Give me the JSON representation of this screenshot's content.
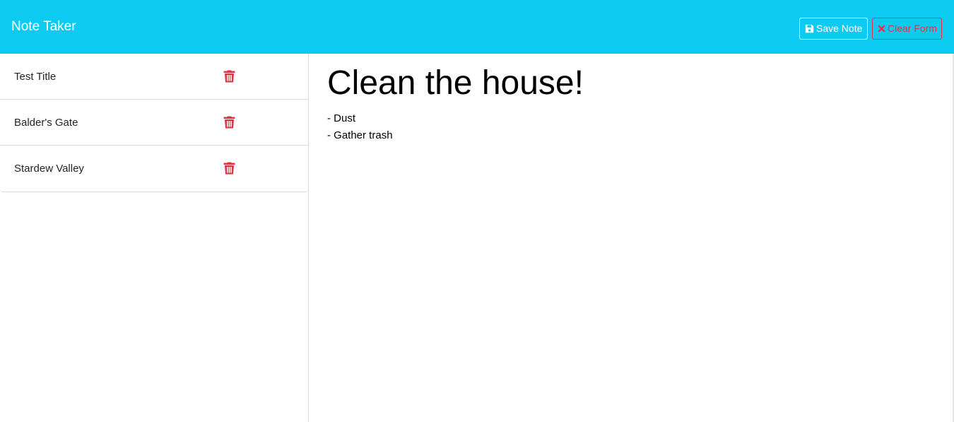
{
  "header": {
    "brand": "Note Taker",
    "save_label": "Save Note",
    "clear_label": "Clear Form",
    "save_icon": "floppy-disk-icon",
    "clear_icon": "x-icon"
  },
  "notes": [
    {
      "title": "Test Title",
      "delete_icon": "trash-icon"
    },
    {
      "title": "Balder's Gate",
      "delete_icon": "trash-icon"
    },
    {
      "title": "Stardew Valley",
      "delete_icon": "trash-icon"
    }
  ],
  "editor": {
    "title": "Clean the house!",
    "text": "- Dust\n- Gather trash"
  },
  "colors": {
    "navbar": "#0dcaf0",
    "danger": "#dc3545",
    "white": "#ffffff"
  }
}
